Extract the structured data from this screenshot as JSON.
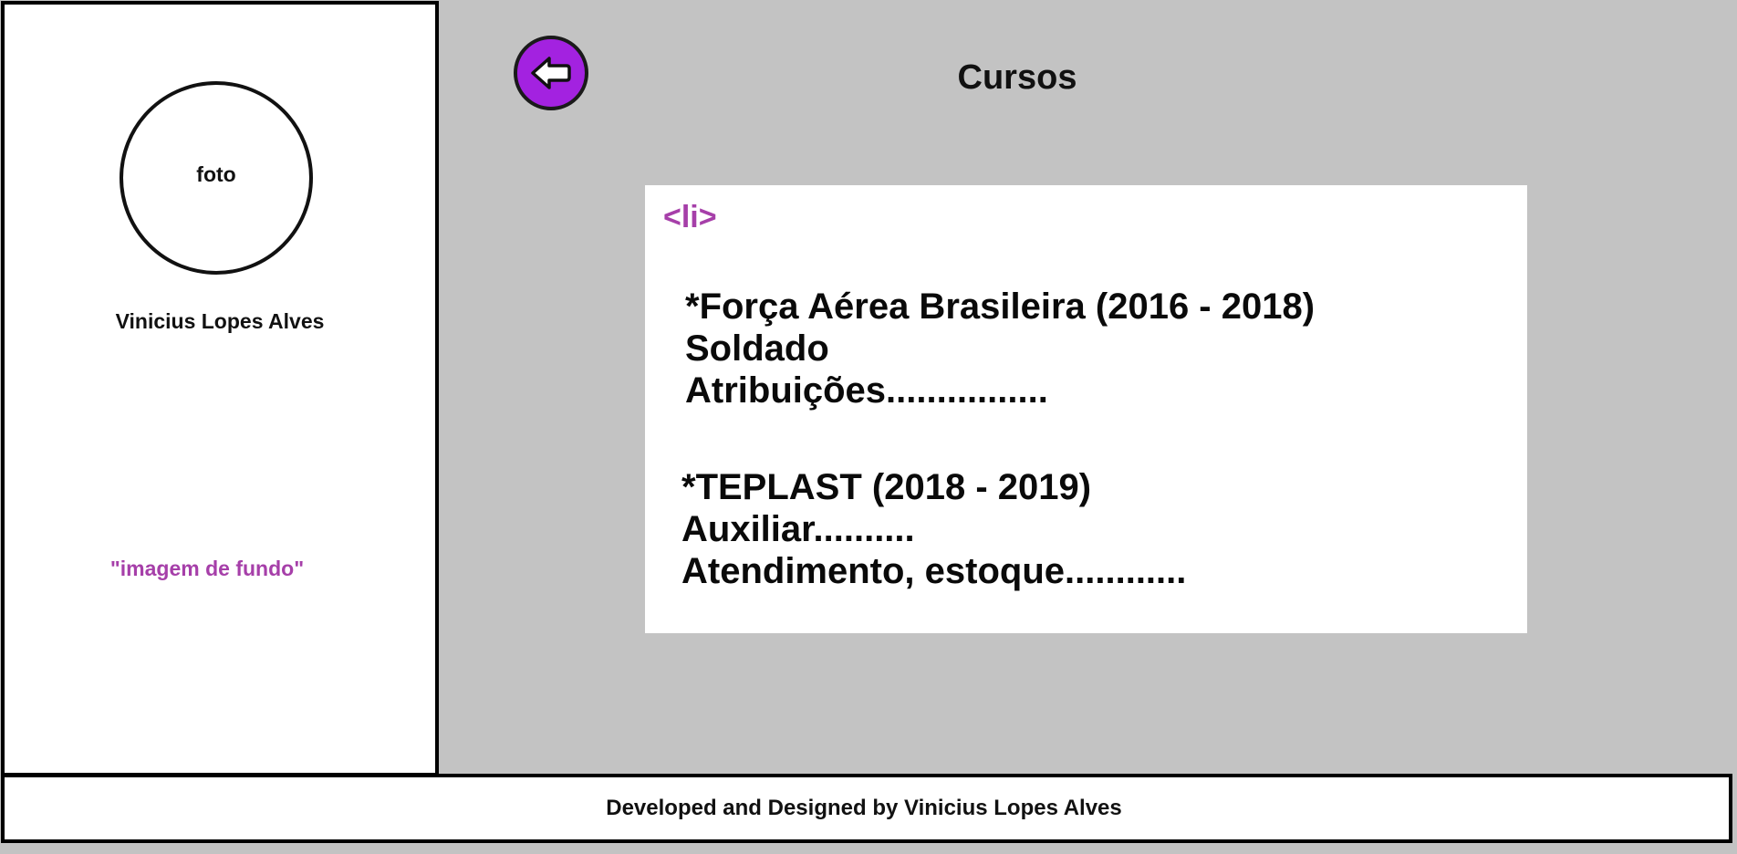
{
  "sidebar": {
    "photo_label": "foto",
    "name": "Vinicius Lopes Alves",
    "background_note": "\"imagem de fundo\""
  },
  "header": {
    "back_icon": "arrow-left-icon",
    "title": "Cursos"
  },
  "card": {
    "tag_label": "<li>",
    "entries": [
      {
        "line1": "*Força Aérea Brasileira (2016 - 2018)",
        "line2": "Soldado",
        "line3": "Atribuições................"
      },
      {
        "line1": "*TEPLAST (2018 - 2019)",
        "line2": "Auxiliar..........",
        "line3": "Atendimento, estoque............"
      }
    ]
  },
  "footer": {
    "text": "Developed and Designed by Vinicius Lopes Alves"
  },
  "colors": {
    "page_background": "#c3c3c3",
    "accent_purple": "#a322e0",
    "annotation_purple": "#a63fa9",
    "panel_background": "#ffffff",
    "border": "#000000"
  }
}
